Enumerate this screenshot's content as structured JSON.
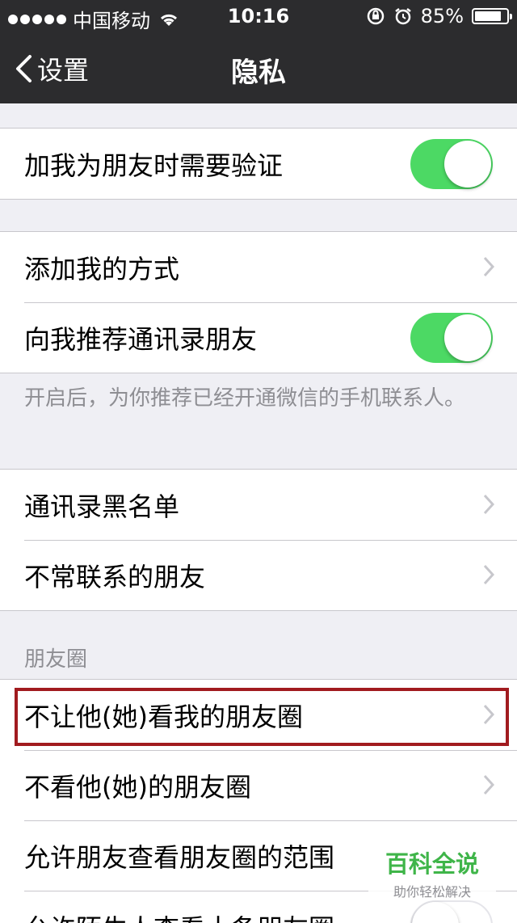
{
  "status_bar": {
    "carrier": "中国移动",
    "time": "10:16",
    "battery_text": "85%",
    "battery_level": 0.85,
    "icons": [
      "signal-dots-icon",
      "wifi-icon",
      "orientation-lock-icon",
      "alarm-icon",
      "battery-icon"
    ]
  },
  "nav": {
    "back_label": "设置",
    "title": "隐私"
  },
  "sections": {
    "verify": {
      "label": "加我为朋友时需要验证",
      "toggle_on": true
    },
    "add_me": {
      "label": "添加我的方式"
    },
    "recommend": {
      "label": "向我推荐通讯录朋友",
      "toggle_on": true
    },
    "recommend_note": "开启后，为你推荐已经开通微信的手机联系人。",
    "blacklist": {
      "label": "通讯录黑名单"
    },
    "infrequent": {
      "label": "不常联系的朋友"
    },
    "moments_header": "朋友圈",
    "hide_from": {
      "label": "不让他(她)看我的朋友圈"
    },
    "dont_see": {
      "label": "不看他(她)的朋友圈"
    },
    "allow_range": {
      "label": "允许朋友查看朋友圈的范围"
    },
    "partial_row": {
      "label": "允许陌生人查看十条朋友圈"
    }
  },
  "watermark": {
    "main": "百科全说",
    "sub": "助你轻松解决"
  },
  "colors": {
    "bar_bg": "#2c2c2e",
    "toggle_on": "#4cd964",
    "highlight": "#a11b1f",
    "watermark_green": "#3fb549"
  }
}
